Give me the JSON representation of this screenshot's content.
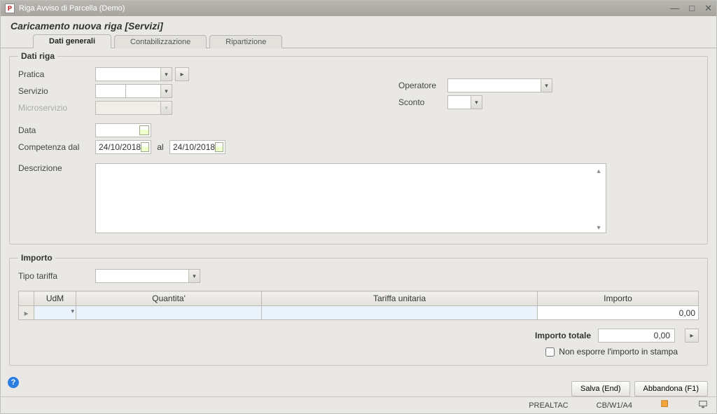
{
  "window": {
    "title": "Riga Avviso di Parcella  (Demo)",
    "subtitle": "Caricamento nuova riga [Servizi]"
  },
  "tabs": [
    {
      "label": "Dati generali",
      "active": true
    },
    {
      "label": "Contabilizzazione",
      "active": false
    },
    {
      "label": "Ripartizione",
      "active": false
    }
  ],
  "group_dati_riga": {
    "legend": "Dati riga",
    "pratica_label": "Pratica",
    "servizio_label": "Servizio",
    "microservizio_label": "Microservizio",
    "data_label": "Data",
    "competenza_dal_label": "Competenza  dal",
    "al_label": "al",
    "descrizione_label": "Descrizione",
    "operatore_label": "Operatore",
    "sconto_label": "Sconto",
    "competenza_dal_value": "24/10/2018",
    "competenza_al_value": "24/10/2018"
  },
  "group_importo": {
    "legend": "Importo",
    "tipo_tariffa_label": "Tipo tariffa",
    "columns": {
      "rowhdr": "",
      "udm": "UdM",
      "quantita": "Quantita'",
      "tariffa": "Tariffa unitaria",
      "importo": "Importo"
    },
    "row1_importo": "0,00",
    "totale_label": "Importo totale",
    "totale_value": "0,00",
    "non_esporre_label": "Non esporre l'importo in stampa"
  },
  "footer": {
    "salva": "Salva (End)",
    "abbandona": "Abbandona (F1)"
  },
  "status": {
    "user": "PREALTAC",
    "context": "CB/W1/A4"
  }
}
